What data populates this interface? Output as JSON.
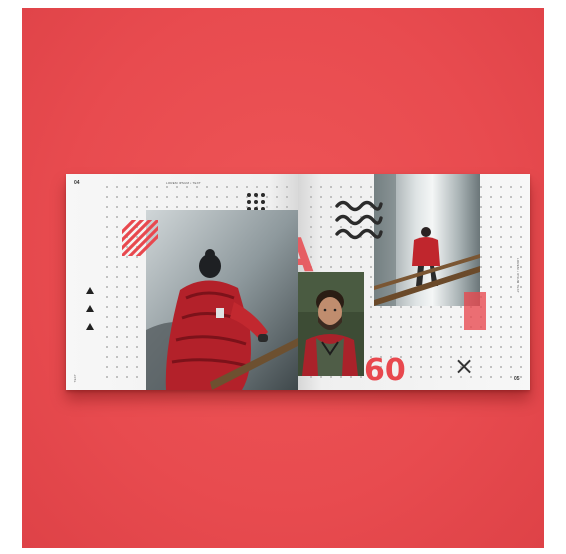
{
  "scene": {
    "background_color": "#e84b4f",
    "accent_color": "#e8484e",
    "dark_color": "#2b2b2b"
  },
  "spread": {
    "left_page": {
      "header_text": "LOREM IPSUM • TEXT",
      "page_number": "04",
      "footer_label": "TEXT"
    },
    "right_page": {
      "side_text": "LOREM • IPSUM TEXT",
      "page_number": "05"
    },
    "display": {
      "letter": "A",
      "number": "60",
      "cross": "×"
    },
    "photos": [
      {
        "name": "hiker-back-photo",
        "subject": "hiker in red jacket and beanie on wooden bridge"
      },
      {
        "name": "portrait-photo",
        "subject": "bearded man in red jacket portrait"
      },
      {
        "name": "waterfall-photo",
        "subject": "hiker crossing bridge before waterfall"
      }
    ]
  }
}
